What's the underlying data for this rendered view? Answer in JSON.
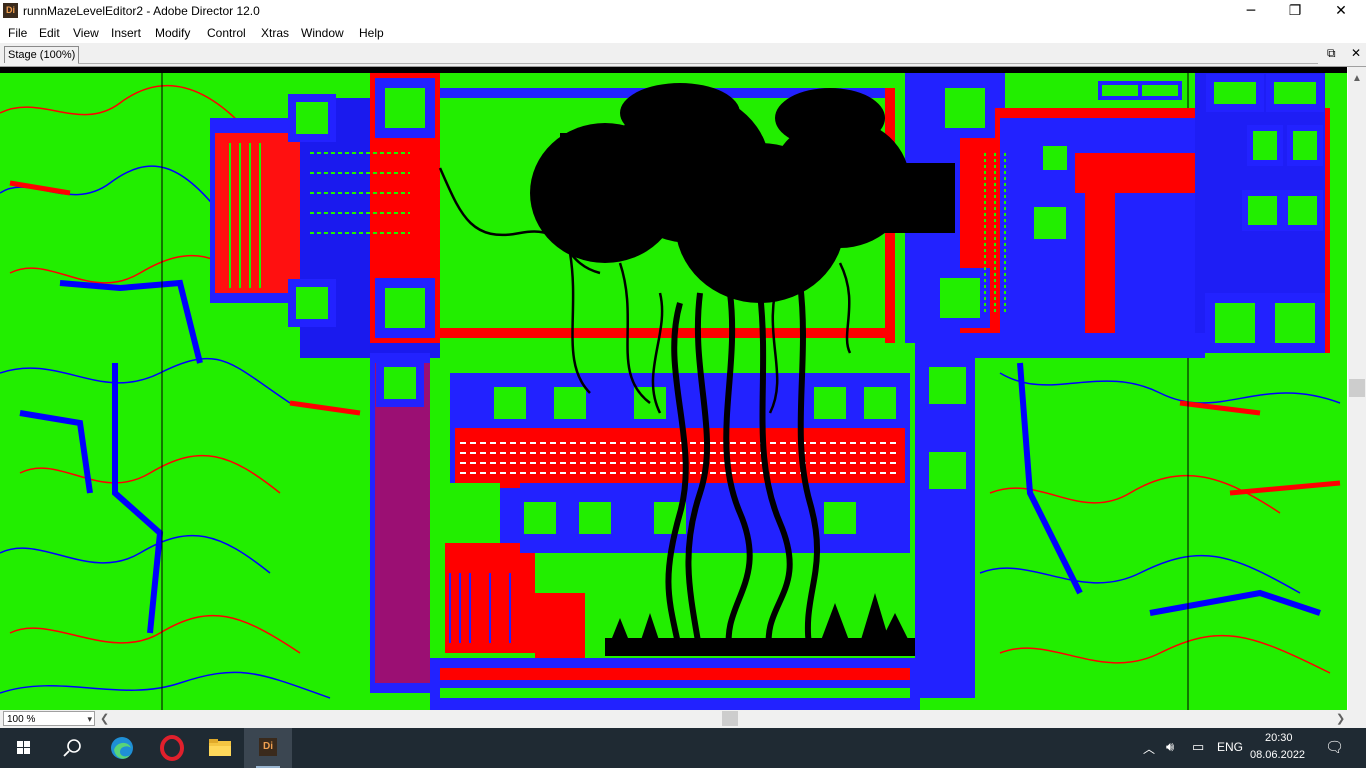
{
  "window": {
    "app_icon_label": "Di",
    "title": "runnMazeLevelEditor2 - Adobe Director 12.0",
    "controls": {
      "minimize": "─",
      "maximize": "❐",
      "close": "✕"
    }
  },
  "menu": {
    "items": [
      "File",
      "Edit",
      "View",
      "Insert",
      "Modify",
      "Control",
      "Xtras",
      "Window",
      "Help"
    ]
  },
  "stage": {
    "tab_label": "Stage (100%)",
    "restore_icon": "restore-icon",
    "close_icon": "close-icon"
  },
  "bottom": {
    "zoom_value": "100 %"
  },
  "taskbar": {
    "apps": [
      "start-icon",
      "search-icon",
      "edge-icon",
      "opera-icon",
      "file-explorer-icon",
      "director-icon"
    ],
    "director_label": "Di",
    "language": "ENG",
    "time": "20:30",
    "date": "08.06.2022"
  },
  "colors": {
    "stage_green": "#22ee00",
    "stage_red": "#ff0000",
    "stage_blue": "#0000ff",
    "taskbar": "#1f2a33"
  }
}
